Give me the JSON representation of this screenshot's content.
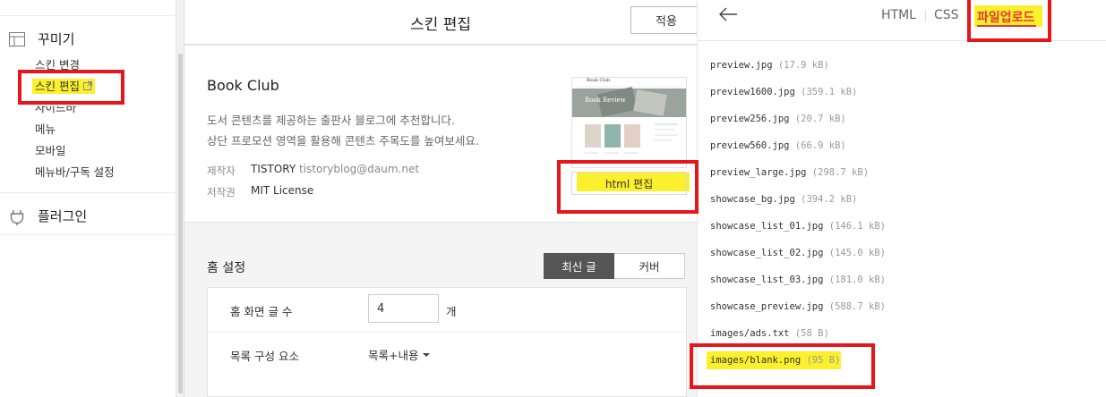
{
  "sidebar": {
    "group_decorate": {
      "label": "꾸미기",
      "icon": "layout-icon"
    },
    "items": [
      {
        "label": "스킨 변경"
      },
      {
        "label": "스킨 편집",
        "external_icon": "external-link-icon"
      },
      {
        "label": "사이드바"
      },
      {
        "label": "메뉴"
      },
      {
        "label": "모바일"
      },
      {
        "label": "메뉴바/구독 설정"
      }
    ],
    "group_plugin": {
      "label": "플러그인",
      "icon": "plug-icon"
    }
  },
  "editor": {
    "title": "스킨 편집",
    "apply_label": "적용",
    "skin": {
      "name": "Book Club",
      "desc1": "도서 콘텐츠를 제공하는 출판사 블로그에 추천합니다.",
      "desc2": "상단 프로모션 영역을 활용해 콘텐츠 주목도를 높여보세요.",
      "maker_key": "제작자",
      "maker_value": "TISTORY",
      "maker_email": "tistoryblog@daum.net",
      "license_key": "저작권",
      "license_value": "MIT License",
      "thumb_title": "Book Club",
      "thumb_banner": "Book Review",
      "html_edit_label": "html 편집"
    },
    "home": {
      "title": "홈 설정",
      "seg_latest": "최신 글",
      "seg_cover": "커버",
      "count_label": "홈 화면 글 수",
      "count_value": "4",
      "count_unit": "개",
      "list_label": "목록 구성 요소",
      "list_value": "목록+내용"
    }
  },
  "files": {
    "back_icon": "arrow-left-icon",
    "tabs": {
      "html": "HTML",
      "css": "CSS",
      "upload": "파일업로드"
    },
    "list": [
      {
        "name": "preview.jpg",
        "size": "(17.9 kB)"
      },
      {
        "name": "preview1600.jpg",
        "size": "(359.1 kB)"
      },
      {
        "name": "preview256.jpg",
        "size": "(20.7 kB)"
      },
      {
        "name": "preview560.jpg",
        "size": "(66.9 kB)"
      },
      {
        "name": "preview_large.jpg",
        "size": "(298.7 kB)"
      },
      {
        "name": "showcase_bg.jpg",
        "size": "(394.2 kB)"
      },
      {
        "name": "showcase_list_01.jpg",
        "size": "(146.1 kB)"
      },
      {
        "name": "showcase_list_02.jpg",
        "size": "(145.0 kB)"
      },
      {
        "name": "showcase_list_03.jpg",
        "size": "(181.0 kB)"
      },
      {
        "name": "showcase_preview.jpg",
        "size": "(588.7 kB)"
      },
      {
        "name": "images/ads.txt",
        "size": "(58 B)"
      },
      {
        "name": "images/blank.png",
        "size": "(95 B)"
      }
    ]
  },
  "colors": {
    "highlight": "#fbf02c",
    "annotation_red": "#e8161b",
    "accent": "#e53935"
  }
}
